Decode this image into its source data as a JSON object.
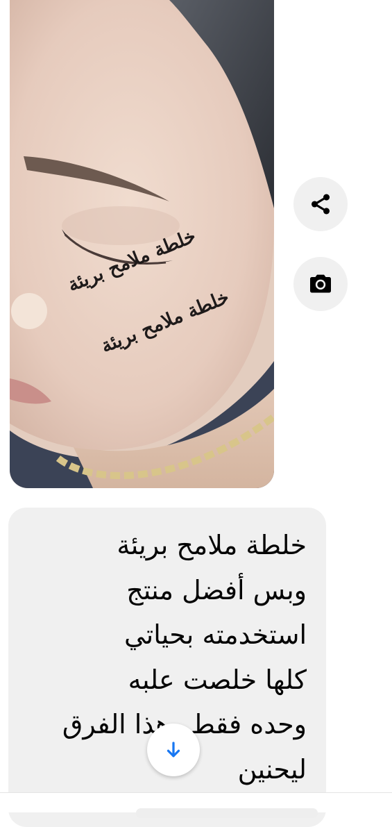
{
  "photo": {
    "overlay_lines": [
      "خلطة ملامح بريئة",
      "خلطة ملامح بريئة"
    ]
  },
  "actions": {
    "share_icon": "share-icon",
    "camera_icon": "camera-icon"
  },
  "message": {
    "lines": [
      "خلطة ملامح بريئة",
      "وبس أفضل منتج",
      "استخدمته بحياتي",
      "كلها خلصت علبه",
      "وحده فقط وهذا الفرق",
      "ليحنين"
    ]
  },
  "scroll_button": {
    "icon": "arrow-down-icon",
    "color": "#1877f2"
  },
  "colors": {
    "bubble": "#f0f0f0",
    "accent": "#1877f2",
    "text": "#050505"
  }
}
